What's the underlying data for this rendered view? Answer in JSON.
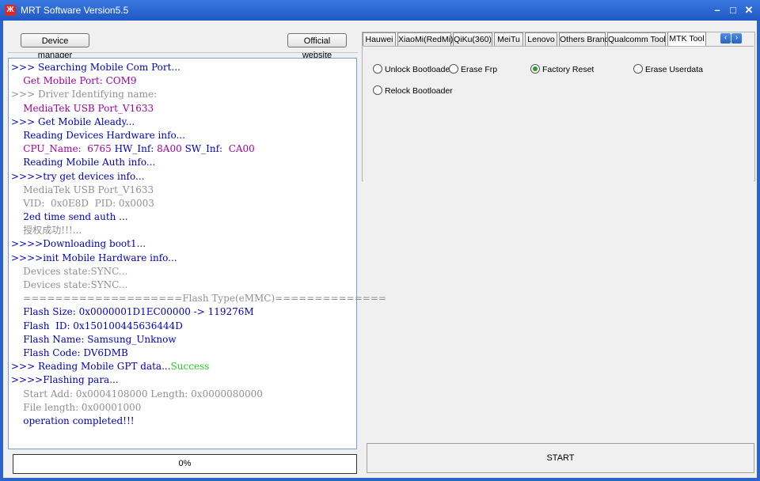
{
  "window": {
    "title": "MRT Software Version5.5",
    "icon_name": "mrt-logo-icon",
    "controls": {
      "minimize": "–",
      "maximize": "□",
      "close": "✕"
    }
  },
  "toolbar": {
    "device_manager": "Device manager",
    "official_website": "Official website"
  },
  "log": [
    {
      "text": ">>> Searching Mobile Com Port...",
      "color": "#0000c0"
    },
    {
      "text": "    Get Mobile Port: COM9",
      "color": "#a000a0"
    },
    {
      "text": ">>> Driver Identifying name:",
      "color": "#909090"
    },
    {
      "text": "    MediaTek USB Port_V1633",
      "color": "#a000a0"
    },
    {
      "text": ">>> Get Mobile Aleady...",
      "color": "#0000c0"
    },
    {
      "text": "    Reading Devices Hardware info...",
      "color": "#0000c0"
    },
    {
      "parts": [
        {
          "text": "    CPU_Name:  ",
          "color": "#a000a0"
        },
        {
          "text": "6765 ",
          "color": "#a000a0"
        },
        {
          "text": "HW_Inf: ",
          "color": "#0000c0"
        },
        {
          "text": "8A00 ",
          "color": "#a000a0"
        },
        {
          "text": "SW_Inf:  ",
          "color": "#0000c0"
        },
        {
          "text": "CA00",
          "color": "#a000a0"
        }
      ]
    },
    {
      "text": "    Reading Mobile Auth info...",
      "color": "#0000c0"
    },
    {
      "text": ">>>>try get devices info...",
      "color": "#0000c0"
    },
    {
      "text": "    MediaTek USB Port_V1633",
      "color": "#909090"
    },
    {
      "text": "    VID:  0x0E8D  PID: 0x0003",
      "color": "#909090"
    },
    {
      "text": "    2ed time send auth ...",
      "color": "#0000c0"
    },
    {
      "text": "    授权成功!!!...",
      "color": "#909090"
    },
    {
      "text": ">>>>Downloading boot1...",
      "color": "#0000c0"
    },
    {
      "text": ">>>>init Mobile Hardware info...",
      "color": "#0000c0"
    },
    {
      "text": "    Devices state:SYNC...",
      "color": "#909090"
    },
    {
      "text": "    Devices state:SYNC...",
      "color": "#909090"
    },
    {
      "text": "    ====================Flash Type(eMMC)==============",
      "color": "#909090"
    },
    {
      "text": "    Flash Size: 0x0000001D1EC00000 -> 119276M",
      "color": "#0000c0"
    },
    {
      "text": "    Flash  ID: 0x150100445636444D",
      "color": "#0000c0"
    },
    {
      "text": "    Flash Name: Samsung_Unknow",
      "color": "#0000c0"
    },
    {
      "text": "    Flash Code: DV6DMB",
      "color": "#0000c0"
    },
    {
      "parts": [
        {
          "text": ">>> Reading Mobile GPT data...",
          "color": "#0000c0"
        },
        {
          "text": "Success",
          "color": "#22cc22"
        }
      ]
    },
    {
      "text": ">>>>Flashing para...",
      "color": "#0000c0"
    },
    {
      "text": "    Start Add: 0x0004108000 Length: 0x0000080000",
      "color": "#909090"
    },
    {
      "text": "    File length: 0x00001000",
      "color": "#909090"
    },
    {
      "text": "    operation completed!!!",
      "color": "#0000c0"
    }
  ],
  "progress": {
    "label": "0%",
    "value": 0
  },
  "tabs": [
    "Hauwei",
    "XiaoMi(RedMi)",
    "QiKu(360)",
    "MeiTu",
    "Lenovo",
    "Others Brand",
    "Qualcomm Tool",
    "MTK Tool"
  ],
  "active_tab": "MTK Tool",
  "tab_scroll": {
    "left": "‹",
    "right": "›"
  },
  "options": [
    {
      "label": "Unlock Bootloader",
      "checked": false
    },
    {
      "label": "Erase Frp",
      "checked": false
    },
    {
      "label": "Factory Reset",
      "checked": true
    },
    {
      "label": "Erase Userdata",
      "checked": false
    },
    {
      "label": "Relock Bootloader",
      "checked": false
    }
  ],
  "start_label": "START"
}
